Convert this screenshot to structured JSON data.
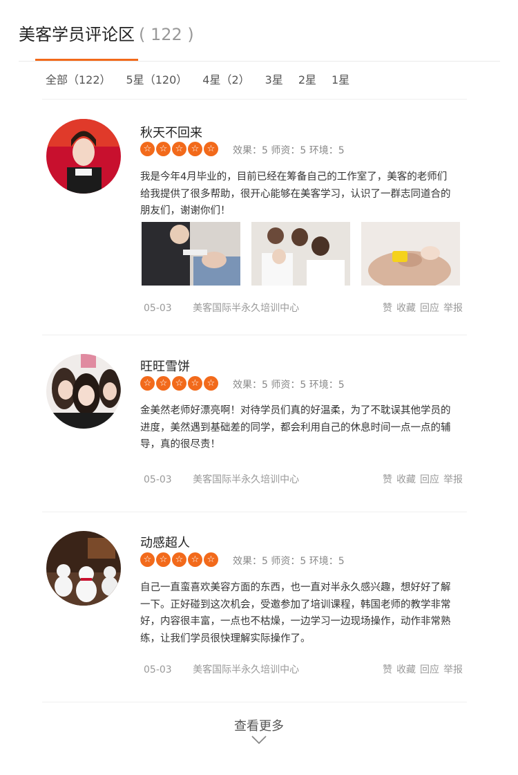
{
  "header": {
    "title": "美客学员评论区",
    "count": "( 122 )"
  },
  "filters": [
    "全部（122）",
    "5星（120）",
    "4星（2）",
    "3星",
    "2星",
    "1星"
  ],
  "colors": {
    "accent": "#f26a1b"
  },
  "reviews": [
    {
      "name": "秋天不回来",
      "rating": 5,
      "scores": "效果：5 师资：5 环境：5",
      "content": "我是今年4月毕业的，目前已经在筹备自己的工作室了，美客的老师们给我提供了很多帮助，很开心能够在美客学习，认识了一群志同道合的朋友们，谢谢你们！",
      "date": "05-03",
      "school": "美客国际半永久培训中心",
      "actions": [
        "赞",
        "收藏",
        "回应",
        "举报"
      ]
    },
    {
      "name": "旺旺雪饼",
      "rating": 5,
      "scores": "效果：5 师资：5 环境：5",
      "content": "金美然老师好漂亮啊！对待学员们真的好温柔，为了不耽误其他学员的进度，美然遇到基础差的同学，都会利用自己的休息时间一点一点的辅导，真的很尽责！",
      "date": "05-03",
      "school": "美客国际半永久培训中心",
      "actions": [
        "赞",
        "收藏",
        "回应",
        "举报"
      ]
    },
    {
      "name": "动感超人",
      "rating": 5,
      "scores": "效果：5 师资：5 环境：5",
      "content": "自己一直蛮喜欢美容方面的东西，也一直对半永久感兴趣，想好好了解一下。正好碰到这次机会，受邀参加了培训课程，韩国老师的教学非常好，内容很丰富，一点也不枯燥，一边学习一边现场操作，动作非常熟练，让我们学员很快理解实际操作了。",
      "date": "05-03",
      "school": "美客国际半永久培训中心",
      "actions": [
        "赞",
        "收藏",
        "回应",
        "举报"
      ]
    }
  ],
  "more": {
    "label": "查看更多"
  }
}
